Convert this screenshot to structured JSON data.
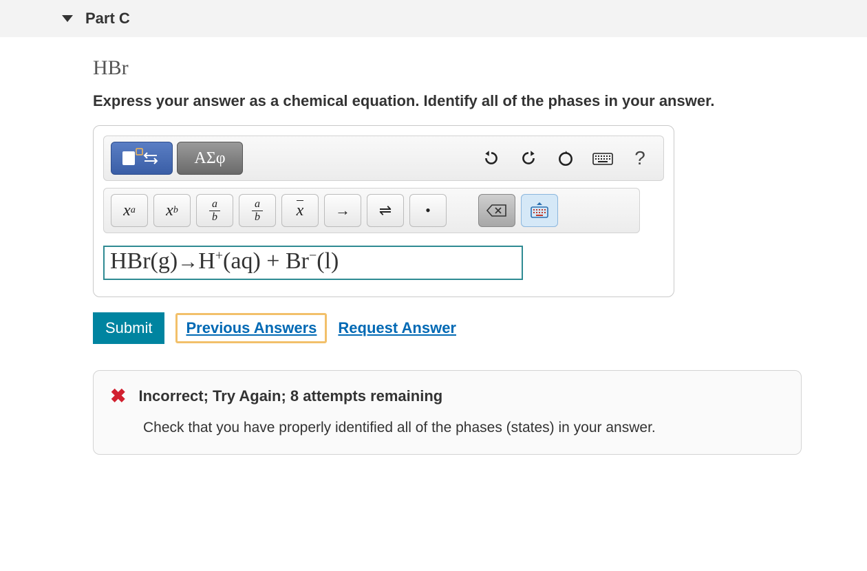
{
  "part": {
    "label": "Part C"
  },
  "question": {
    "compound": "HBr",
    "instruction": "Express your answer as a chemical equation. Identify all of the phases in your answer."
  },
  "toolbar": {
    "greek_label": "ΑΣφ",
    "math": {
      "superscript": "x",
      "superscript_exp": "a",
      "subscript": "x",
      "subscript_sub": "b",
      "frac_stack_top": "a",
      "frac_stack_bot": "b",
      "frac_inline_top": "a",
      "frac_inline_bot": "b",
      "xbar": "x",
      "arrow_right": "→",
      "equilibrium": "⇌",
      "dot": "•"
    }
  },
  "answer": {
    "display": "HBr(g)→H⁺(aq) + Br⁻(l)",
    "reactant": "HBr(g)",
    "arrow": "→",
    "p1": "H",
    "p1_charge": "+",
    "p1_phase": "(aq)",
    "plus": " + ",
    "p2": "Br",
    "p2_charge": "−",
    "p2_phase": "(l)"
  },
  "actions": {
    "submit": "Submit",
    "previous": "Previous Answers",
    "request": "Request Answer"
  },
  "feedback": {
    "title": "Incorrect; Try Again; 8 attempts remaining",
    "body": "Check that you have properly identified all of the phases (states) in your answer."
  }
}
